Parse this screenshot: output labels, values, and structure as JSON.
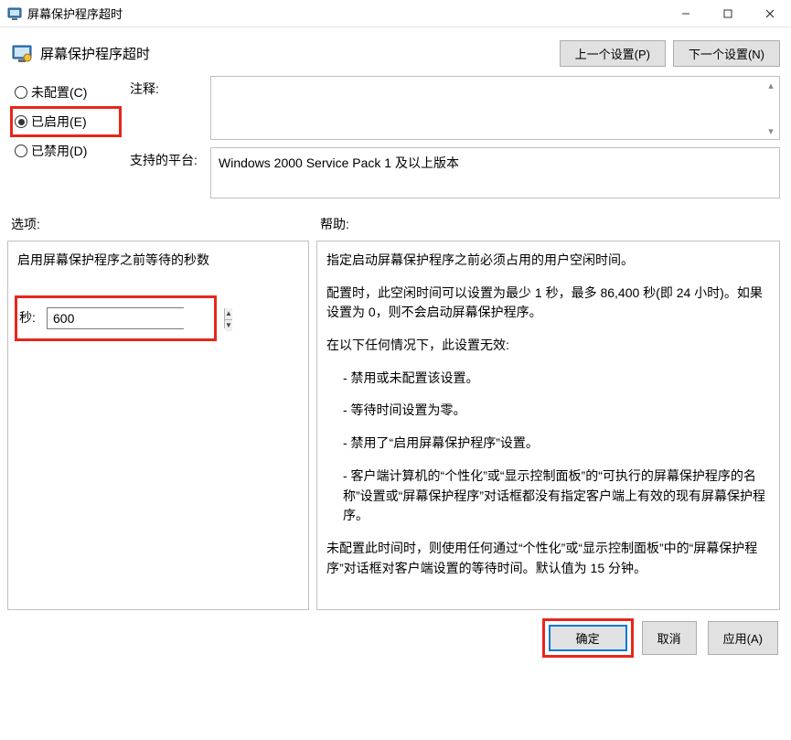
{
  "window": {
    "title": "屏幕保护程序超时"
  },
  "header": {
    "title": "屏幕保护程序超时",
    "prev_btn": "上一个设置(P)",
    "next_btn": "下一个设置(N)"
  },
  "radios": {
    "not_configured": "未配置(C)",
    "enabled": "已启用(E)",
    "disabled": "已禁用(D)",
    "selected": "enabled"
  },
  "comment": {
    "label": "注释:",
    "value": ""
  },
  "supported": {
    "label": "支持的平台:",
    "value": "Windows 2000 Service Pack 1 及以上版本"
  },
  "sections": {
    "options_label": "选项:",
    "help_label": "帮助:"
  },
  "options": {
    "heading": "启用屏幕保护程序之前等待的秒数",
    "seconds_label": "秒:",
    "seconds_value": "600"
  },
  "help": {
    "p1": "指定启动屏幕保护程序之前必须占用的用户空闲时间。",
    "p2": "配置时，此空闲时间可以设置为最少 1 秒，最多 86,400 秒(即 24 小时)。如果设置为 0，则不会启动屏幕保护程序。",
    "p3": "在以下任何情况下，此设置无效:",
    "b1": "- 禁用或未配置该设置。",
    "b2": "- 等待时间设置为零。",
    "b3": "- 禁用了“启用屏幕保护程序”设置。",
    "b4": "- 客户端计算机的“个性化”或“显示控制面板”的“可执行的屏幕保护程序的名称”设置或“屏幕保护程序”对话框都没有指定客户端上有效的现有屏幕保护程序。",
    "p4": "未配置此时间时，则使用任何通过“个性化”或“显示控制面板”中的“屏幕保护程序”对话框对客户端设置的等待时间。默认值为 15 分钟。"
  },
  "footer": {
    "ok": "确定",
    "cancel": "取消",
    "apply": "应用(A)"
  }
}
